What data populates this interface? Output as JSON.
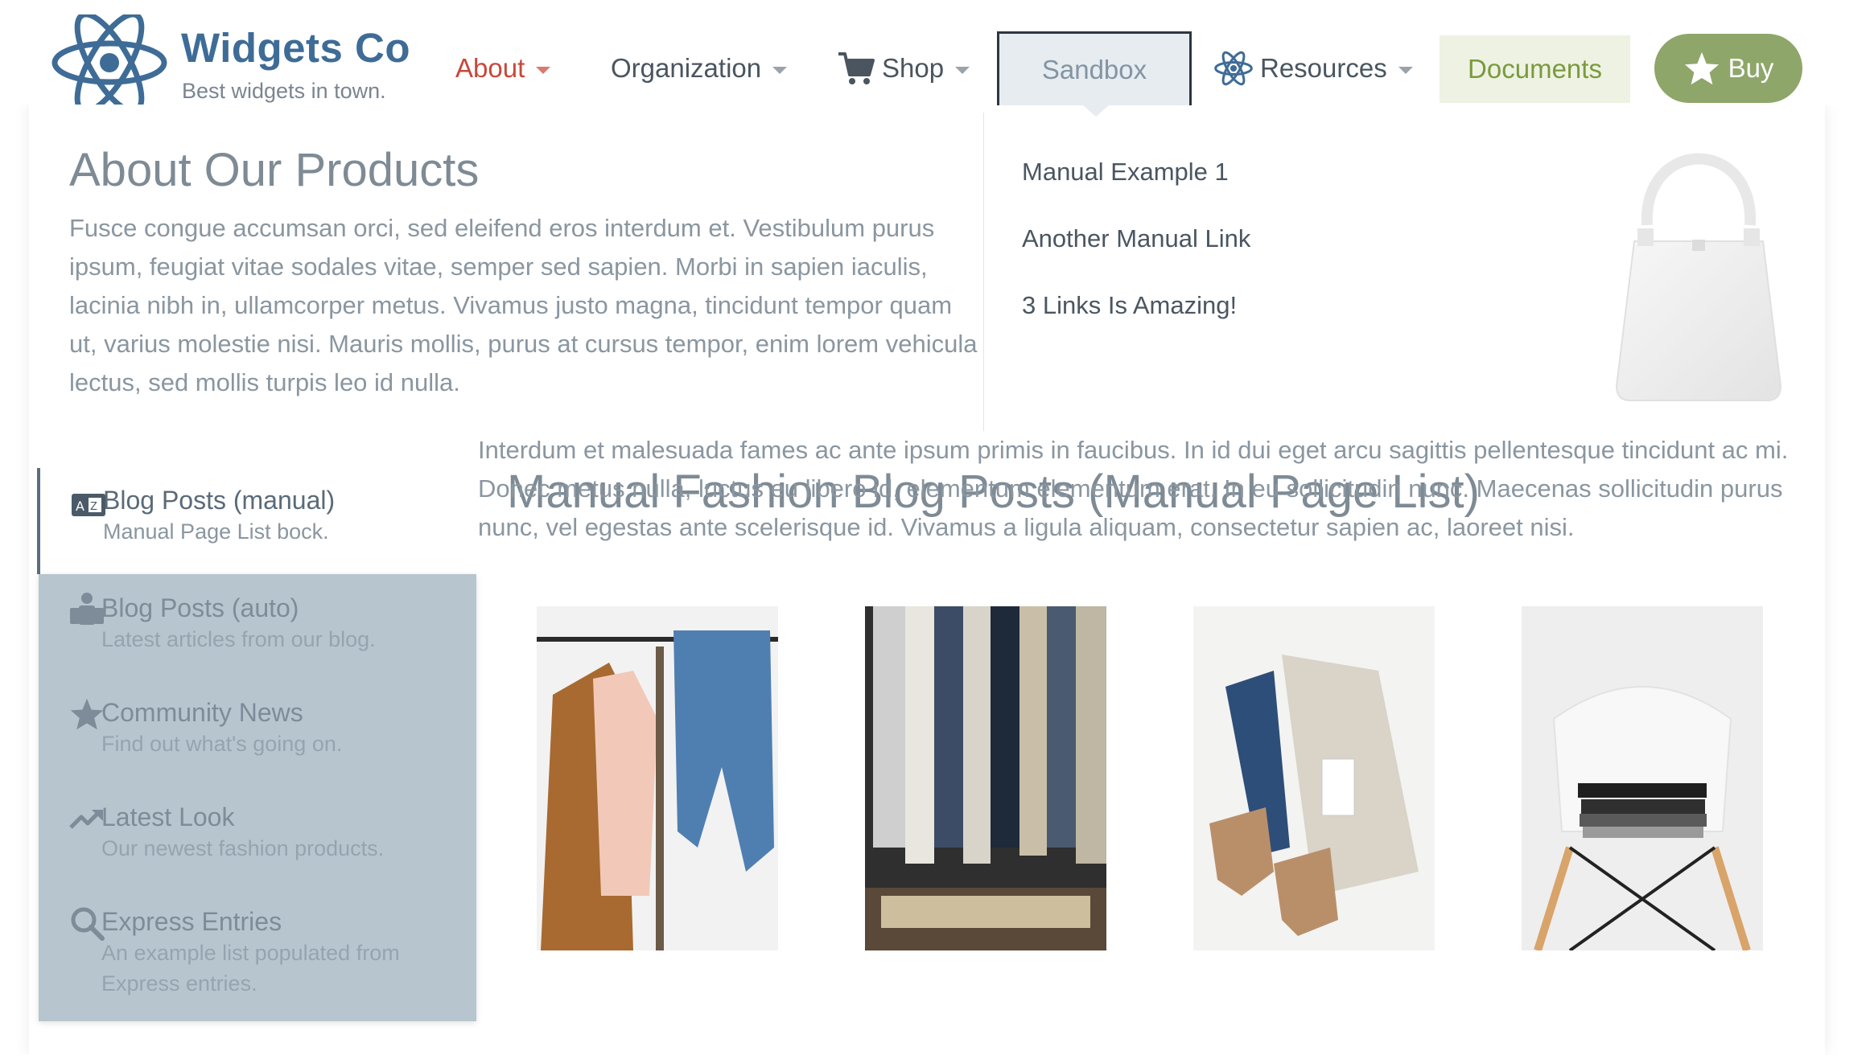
{
  "header": {
    "brand_title": "Widgets Co",
    "brand_tagline": "Best widgets in town.",
    "nav": {
      "about": "About",
      "organization": "Organization",
      "shop": "Shop",
      "sandbox": "Sandbox",
      "resources": "Resources",
      "documents": "Documents",
      "buy": "Buy"
    }
  },
  "mega_menu": {
    "heading": "About Our Products",
    "text": "Fusce congue accumsan orci, sed eleifend eros interdum et. Vestibulum purus ipsum, feugiat vitae sodales vitae, semper sed sapien. Morbi in sapien iaculis, lacinia nibh in, ullamcorper metus. Vivamus justo magna, tincidunt tempor quam ut, varius molestie nisi. Mauris mollis, purus at cursus tempor, enim lorem vehicula lectus, sed mollis turpis leo id nulla.",
    "links": [
      "Manual Example 1",
      "Another Manual Link",
      "3 Links Is Amazing!"
    ]
  },
  "sidebar": {
    "items": [
      {
        "title": "Blog Posts (manual)",
        "desc": "Manual Page List bock.",
        "icon": "id-card-icon",
        "active": true
      },
      {
        "title": "Blog Posts (auto)",
        "desc": "Latest articles from our blog.",
        "icon": "users-icon"
      },
      {
        "title": "Community News",
        "desc": "Find out what's going on.",
        "icon": "star-icon"
      },
      {
        "title": "Latest Look",
        "desc": "Our newest fashion products.",
        "icon": "trending-up-icon"
      },
      {
        "title": "Express Entries",
        "desc_line1": "An example list populated from",
        "desc_line2": "Express entries.",
        "icon": "search-icon"
      }
    ]
  },
  "main": {
    "title": "Manual Fashion Blog Posts (Manual Page List)",
    "text": "Interdum et malesuada fames ac ante ipsum primis in faucibus. In id dui eget arcu sagittis pellentesque tincidunt ac mi. Donec metus nulla, luctus eu libero id, elementum elementum erat. In eu sollicitudin nunc. Maecenas sollicitudin purus nunc, vel egestas ante scelerisque id. Vivamus a ligula aliquam, consectetur sapien ac, laoreet nisi."
  },
  "colors": {
    "brand_blue": "#3e6c97",
    "about_red": "#c8473a",
    "documents_green": "#7a9a3d",
    "buy_green": "#8fa66a",
    "sidebar_bg": "#b7c5ce"
  }
}
